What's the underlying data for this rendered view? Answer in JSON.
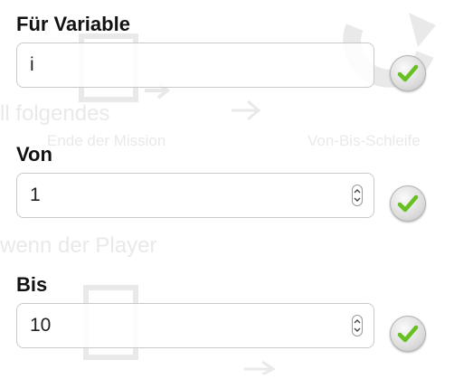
{
  "background": {
    "texts": [
      "Ende der Mission",
      "Von-Bis-Schleife",
      "ll folgendes",
      "wenn der Player"
    ]
  },
  "form": {
    "fields": [
      {
        "label": "Für Variable",
        "value": "i",
        "has_spinner": false
      },
      {
        "label": "Von",
        "value": "1",
        "has_spinner": true
      },
      {
        "label": "Bis",
        "value": "10",
        "has_spinner": true
      }
    ]
  },
  "icons": {
    "confirm": "checkmark-icon",
    "spinner_up": "chevron-up-icon",
    "spinner_down": "chevron-down-icon"
  },
  "colors": {
    "check_green": "#66c01f",
    "faded_illustration": "#e9e9e9"
  }
}
